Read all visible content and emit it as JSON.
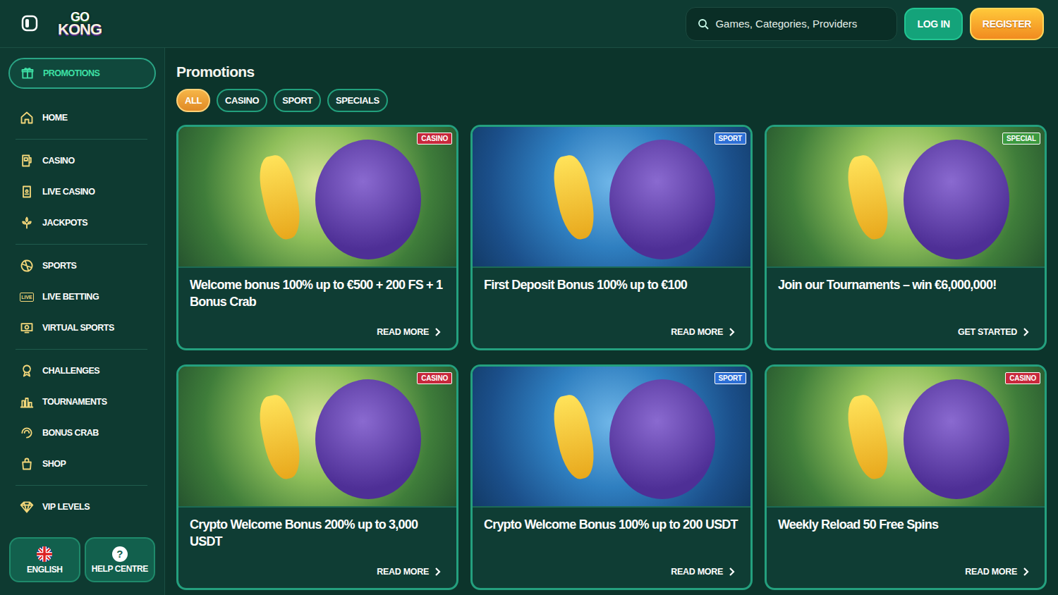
{
  "header": {
    "logo": {
      "top": "GO",
      "bottom": "KONG"
    },
    "search": {
      "placeholder": "Games, Categories, Providers"
    },
    "buttons": [
      {
        "label": "LOG IN",
        "kind": "login"
      },
      {
        "label": "REGISTER",
        "kind": "register"
      }
    ]
  },
  "sidebar": {
    "groups": [
      [
        {
          "label": "PROMOTIONS",
          "selected": true
        }
      ],
      [
        {
          "label": "HOME",
          "selected": false
        }
      ],
      [
        {
          "label": "CASINO",
          "selected": false
        },
        {
          "label": "LIVE CASINO",
          "selected": false
        },
        {
          "label": "JACKPOTS",
          "selected": false
        }
      ],
      [
        {
          "label": "SPORTS",
          "selected": false
        },
        {
          "label": "LIVE BETTING",
          "selected": false,
          "icon_text": "LIVE"
        },
        {
          "label": "VIRTUAL SPORTS",
          "selected": false
        }
      ],
      [
        {
          "label": "CHALLENGES",
          "selected": false
        },
        {
          "label": "TOURNAMENTS",
          "selected": false
        },
        {
          "label": "BONUS CRAB",
          "selected": false
        },
        {
          "label": "SHOP",
          "selected": false
        }
      ],
      [
        {
          "label": "VIP LEVELS",
          "selected": false
        }
      ]
    ],
    "footer_buttons": [
      {
        "label": "ENGLISH",
        "kind": "flag"
      },
      {
        "label": "HELP CENTRE",
        "kind": "help",
        "glyph": "?"
      }
    ]
  },
  "page": {
    "title": "Promotions",
    "filters": [
      {
        "label": "ALL",
        "selected": true
      },
      {
        "label": "CASINO",
        "selected": false
      },
      {
        "label": "SPORT",
        "selected": false
      },
      {
        "label": "SPECIALS",
        "selected": false
      }
    ],
    "cards": [
      {
        "tag": "CASINO",
        "color": "#c8283c",
        "kind": "jungle",
        "title": "Welcome bonus 100% up to €500 + 200 FS + 1 Bonus Crab",
        "link": "READ MORE"
      },
      {
        "tag": "SPORT",
        "color": "#2d6fd6",
        "kind": "pitch",
        "title": "First Deposit Bonus 100% up to €100",
        "link": "READ MORE"
      },
      {
        "tag": "SPECIAL",
        "color": "#3c9a3f",
        "kind": "jungle",
        "title": "Join our Tournaments – win €6,000,000!",
        "link": "GET STARTED"
      },
      {
        "tag": "CASINO",
        "color": "#c8283c",
        "kind": "jungle",
        "title": "Crypto Welcome Bonus 200% up to 3,000 USDT",
        "link": "READ MORE"
      },
      {
        "tag": "SPORT",
        "color": "#2d6fd6",
        "kind": "pitch",
        "title": "Crypto Welcome Bonus 100% up to 200 USDT",
        "link": "READ MORE"
      },
      {
        "tag": "CASINO",
        "color": "#c8283c",
        "kind": "jungle",
        "title": "Weekly Reload 50 Free Spins",
        "link": "READ MORE"
      }
    ]
  }
}
